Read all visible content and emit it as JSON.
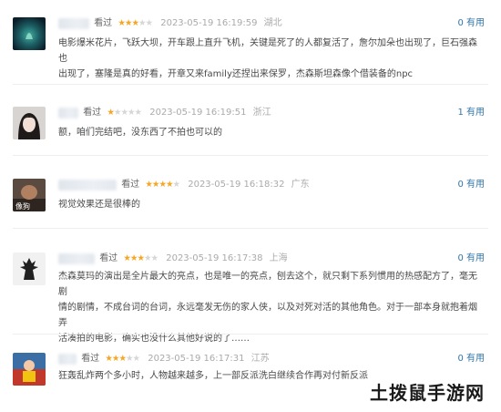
{
  "reviews": [
    {
      "watched": "看过",
      "stars": 3,
      "time": "2023-05-19 16:19:59",
      "region": "湖北",
      "useful": "0 有用",
      "lines": [
        "电影爆米花片，飞跃大坝，开车跟上直升飞机，关键是死了的人都复活了，詹尔加朵也出现了，巨石强森也",
        "出现了，塞隆是真的好看，开章又来family还捏出来保罗，杰森斯坦森像个借装备的npc"
      ]
    },
    {
      "watched": "看过",
      "stars": 1,
      "time": "2023-05-19 16:19:51",
      "region": "浙江",
      "useful": "1 有用",
      "lines": [
        "额，咱们完结吧，没东西了不拍也可以的"
      ]
    },
    {
      "watched": "看过",
      "stars": 4,
      "time": "2023-05-19 16:18:32",
      "region": "广东",
      "useful": "0 有用",
      "lines": [
        "视觉效果还是很棒的"
      ]
    },
    {
      "watched": "看过",
      "stars": 3,
      "time": "2023-05-19 16:17:38",
      "region": "上海",
      "useful": "0 有用",
      "lines": [
        "杰森莫玛的演出是全片最大的亮点，也是唯一的亮点，刨去这个，就只剩下系列惯用的热感配方了，毫无剧",
        "情的剧情，不成台词的台词，永远毫发无伤的家人侠，以及对死对活的其他角色。对于一部本身就抱着烟弄",
        "活凑拍的电影，确实也没什么其他好说的了……"
      ]
    },
    {
      "watched": "看过",
      "stars": 3,
      "time": "2023-05-19 16:17:31",
      "region": "江苏",
      "useful": "0 有用",
      "lines": [
        "狂轰乱炸两个多小时，人物越来越多，上一部反派洗白继续合作再对付新反派"
      ]
    }
  ],
  "watermark": "土拨鼠手游网",
  "colors": {
    "star_on": "#f5a623",
    "star_off": "#d6d6d6",
    "useful_link": "#3377aa",
    "meta_gray": "#aaaaaa",
    "body_text": "#494949"
  }
}
